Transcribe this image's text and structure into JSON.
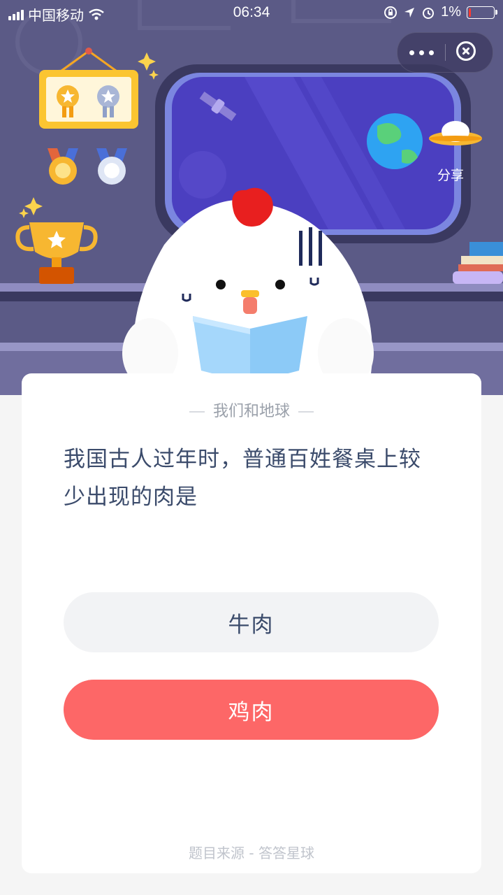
{
  "status_bar": {
    "carrier": "中国移动",
    "time": "06:34",
    "battery": "1%"
  },
  "capsule": {
    "more_icon": "more-dots-icon",
    "close_icon": "close-circle-icon"
  },
  "header": {
    "share_label": "分享"
  },
  "card": {
    "category": "我们和地球",
    "question": "我国古人过年时，普通百姓餐桌上较少出现的肉是",
    "options": [
      {
        "label": "牛肉"
      },
      {
        "label": "鸡肉"
      }
    ],
    "source": "题目来源 - 答答星球"
  },
  "colors": {
    "header_bg": "#5b5a86",
    "window_glass": "#4b3fc0",
    "option_selected": "#fd6767",
    "option_default": "#f2f3f5",
    "question_text": "#3b4b6b"
  }
}
